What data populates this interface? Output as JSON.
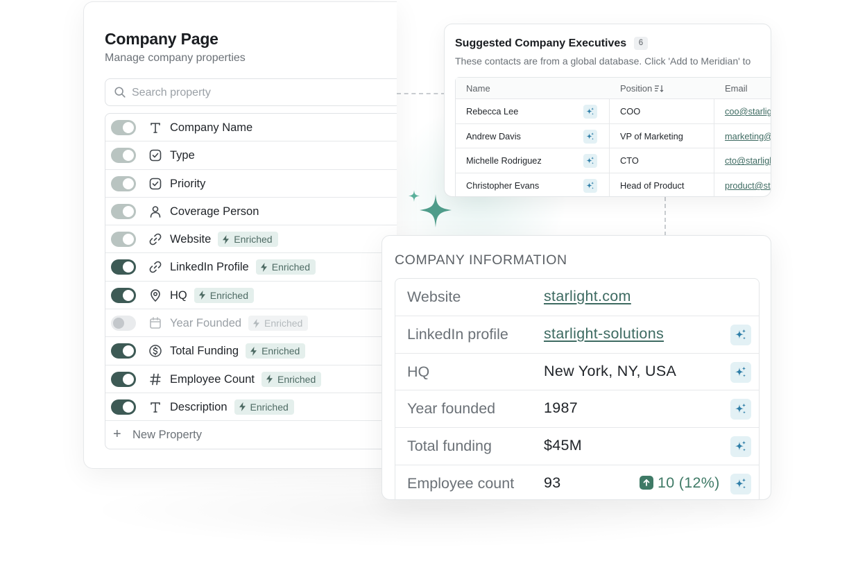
{
  "company_page": {
    "title": "Company Page",
    "subtitle": "Manage company properties",
    "search_placeholder": "Search property",
    "new_property_label": "New Property",
    "enriched_label": "Enriched",
    "properties": [
      {
        "name": "Company Name",
        "icon": "text-icon",
        "toggle": "locked",
        "enriched": false
      },
      {
        "name": "Type",
        "icon": "checkbox-icon",
        "toggle": "locked",
        "enriched": false
      },
      {
        "name": "Priority",
        "icon": "checkbox-icon",
        "toggle": "locked",
        "enriched": false
      },
      {
        "name": "Coverage Person",
        "icon": "person-icon",
        "toggle": "locked",
        "enriched": false
      },
      {
        "name": "Website",
        "icon": "link-icon",
        "toggle": "locked",
        "enriched": true
      },
      {
        "name": "LinkedIn Profile",
        "icon": "link-icon",
        "toggle": "on",
        "enriched": true
      },
      {
        "name": "HQ",
        "icon": "location-pin-icon",
        "toggle": "on",
        "enriched": true
      },
      {
        "name": "Year Founded",
        "icon": "calendar-icon",
        "toggle": "off",
        "enriched": true
      },
      {
        "name": "Total Funding",
        "icon": "dollar-icon",
        "toggle": "on",
        "enriched": true
      },
      {
        "name": "Employee Count",
        "icon": "hash-icon",
        "toggle": "on",
        "enriched": true
      },
      {
        "name": "Description",
        "icon": "text-icon",
        "toggle": "on",
        "enriched": true
      }
    ]
  },
  "executives": {
    "title": "Suggested Company Executives",
    "count": "6",
    "subtitle": "These contacts are from a global database. Click 'Add to Meridian' to",
    "columns": {
      "name": "Name",
      "position": "Position",
      "email": "Email"
    },
    "rows": [
      {
        "name": "Rebecca Lee",
        "position": "COO",
        "email": "coo@starlig"
      },
      {
        "name": "Andrew Davis",
        "position": "VP of Marketing",
        "email": "marketing@"
      },
      {
        "name": "Michelle Rodriguez",
        "position": "CTO",
        "email": "cto@starligh"
      },
      {
        "name": "Christopher Evans",
        "position": "Head of Product",
        "email": "product@st"
      }
    ]
  },
  "company_info": {
    "title": "COMPANY INFORMATION",
    "rows": [
      {
        "label": "Website",
        "value": "starlight.com",
        "link": true,
        "ai": false
      },
      {
        "label": "LinkedIn profile",
        "value": "starlight-solutions",
        "link": true,
        "ai": true
      },
      {
        "label": "HQ",
        "value": "New York, NY, USA",
        "link": false,
        "ai": true
      },
      {
        "label": "Year founded",
        "value": "1987",
        "link": false,
        "ai": true
      },
      {
        "label": "Total funding",
        "value": "$45M",
        "link": false,
        "ai": true
      },
      {
        "label": "Employee count",
        "value": "93",
        "link": false,
        "ai": true,
        "growth": "10 (12%)"
      }
    ]
  },
  "colors": {
    "accent_dark": "#3d5a55",
    "enriched_bg": "#e4efec",
    "link": "#3d6a61",
    "ai_bg": "#e3f1f5",
    "growth": "#3f7a66"
  }
}
